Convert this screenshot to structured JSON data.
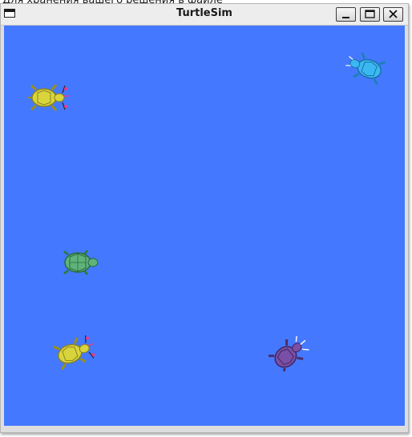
{
  "background_text": "Для хранения вашего решения в файле",
  "window": {
    "title": "TurtleSim",
    "controls": {
      "minimize_icon": "minimize-icon",
      "maximize_icon": "maximize-icon",
      "close_icon": "close-icon"
    }
  },
  "canvas": {
    "background_color": "#4479ff"
  },
  "turtles": [
    {
      "name": "yellow-turtle-top",
      "color": "#d6d23a",
      "heading_deg": 0
    },
    {
      "name": "cyan-turtle",
      "color": "#39b6f0",
      "heading_deg": 200
    },
    {
      "name": "green-turtle",
      "color": "#5fb37a",
      "heading_deg": 0
    },
    {
      "name": "yellow-turtle-bottom",
      "color": "#d6d23a",
      "heading_deg": 340
    },
    {
      "name": "purple-turtle",
      "color": "#7a4fa6",
      "heading_deg": 320
    }
  ]
}
